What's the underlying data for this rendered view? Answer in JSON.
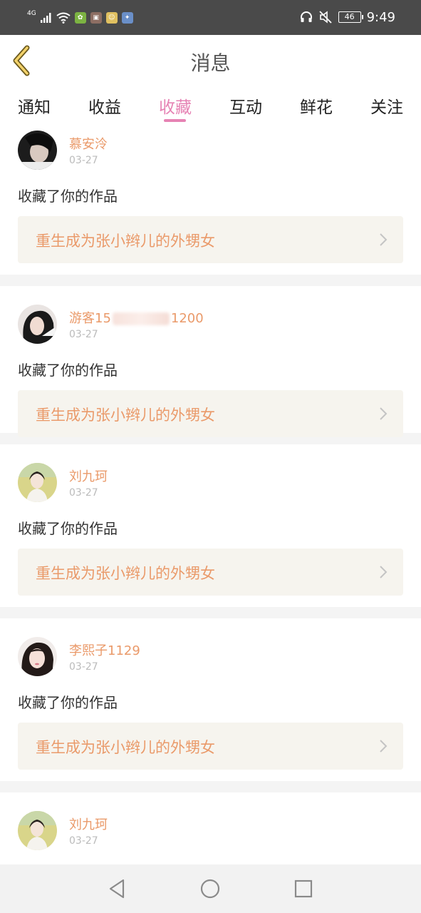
{
  "status_bar": {
    "network": "4G",
    "battery": "46",
    "time": "9:49"
  },
  "header": {
    "title": "消息"
  },
  "tabs": [
    {
      "label": "通知"
    },
    {
      "label": "收益"
    },
    {
      "label": "收藏",
      "active": true
    },
    {
      "label": "互动"
    },
    {
      "label": "鲜花"
    },
    {
      "label": "关注"
    }
  ],
  "feed": [
    {
      "user": "慕安泠",
      "date": "03-27",
      "action": "收藏了你的作品",
      "work": "重生成为张小辫儿的外甥女",
      "avatar": "dark-portrait-avatar"
    },
    {
      "user_prefix": "游客15",
      "user_suffix": "1200",
      "date": "03-27",
      "action": "收藏了你的作品",
      "work": "重生成为张小辫儿的外甥女",
      "avatar": "girl-avatar"
    },
    {
      "user": "刘九珂",
      "date": "03-27",
      "action": "收藏了你的作品",
      "work": "重生成为张小辫儿的外甥女",
      "avatar": "field-girl-avatar"
    },
    {
      "user": "李熙子1129",
      "date": "03-27",
      "action": "收藏了你的作品",
      "work": "重生成为张小辫儿的外甥女",
      "avatar": "girl-avatar"
    },
    {
      "user": "刘九珂",
      "date": "03-27",
      "avatar": "field-girl-avatar"
    }
  ],
  "colors": {
    "accent": "#e683b4",
    "username": "#ea9a6a",
    "status_bar": "#4a4a4a",
    "work_box": "#f6f4ee"
  }
}
